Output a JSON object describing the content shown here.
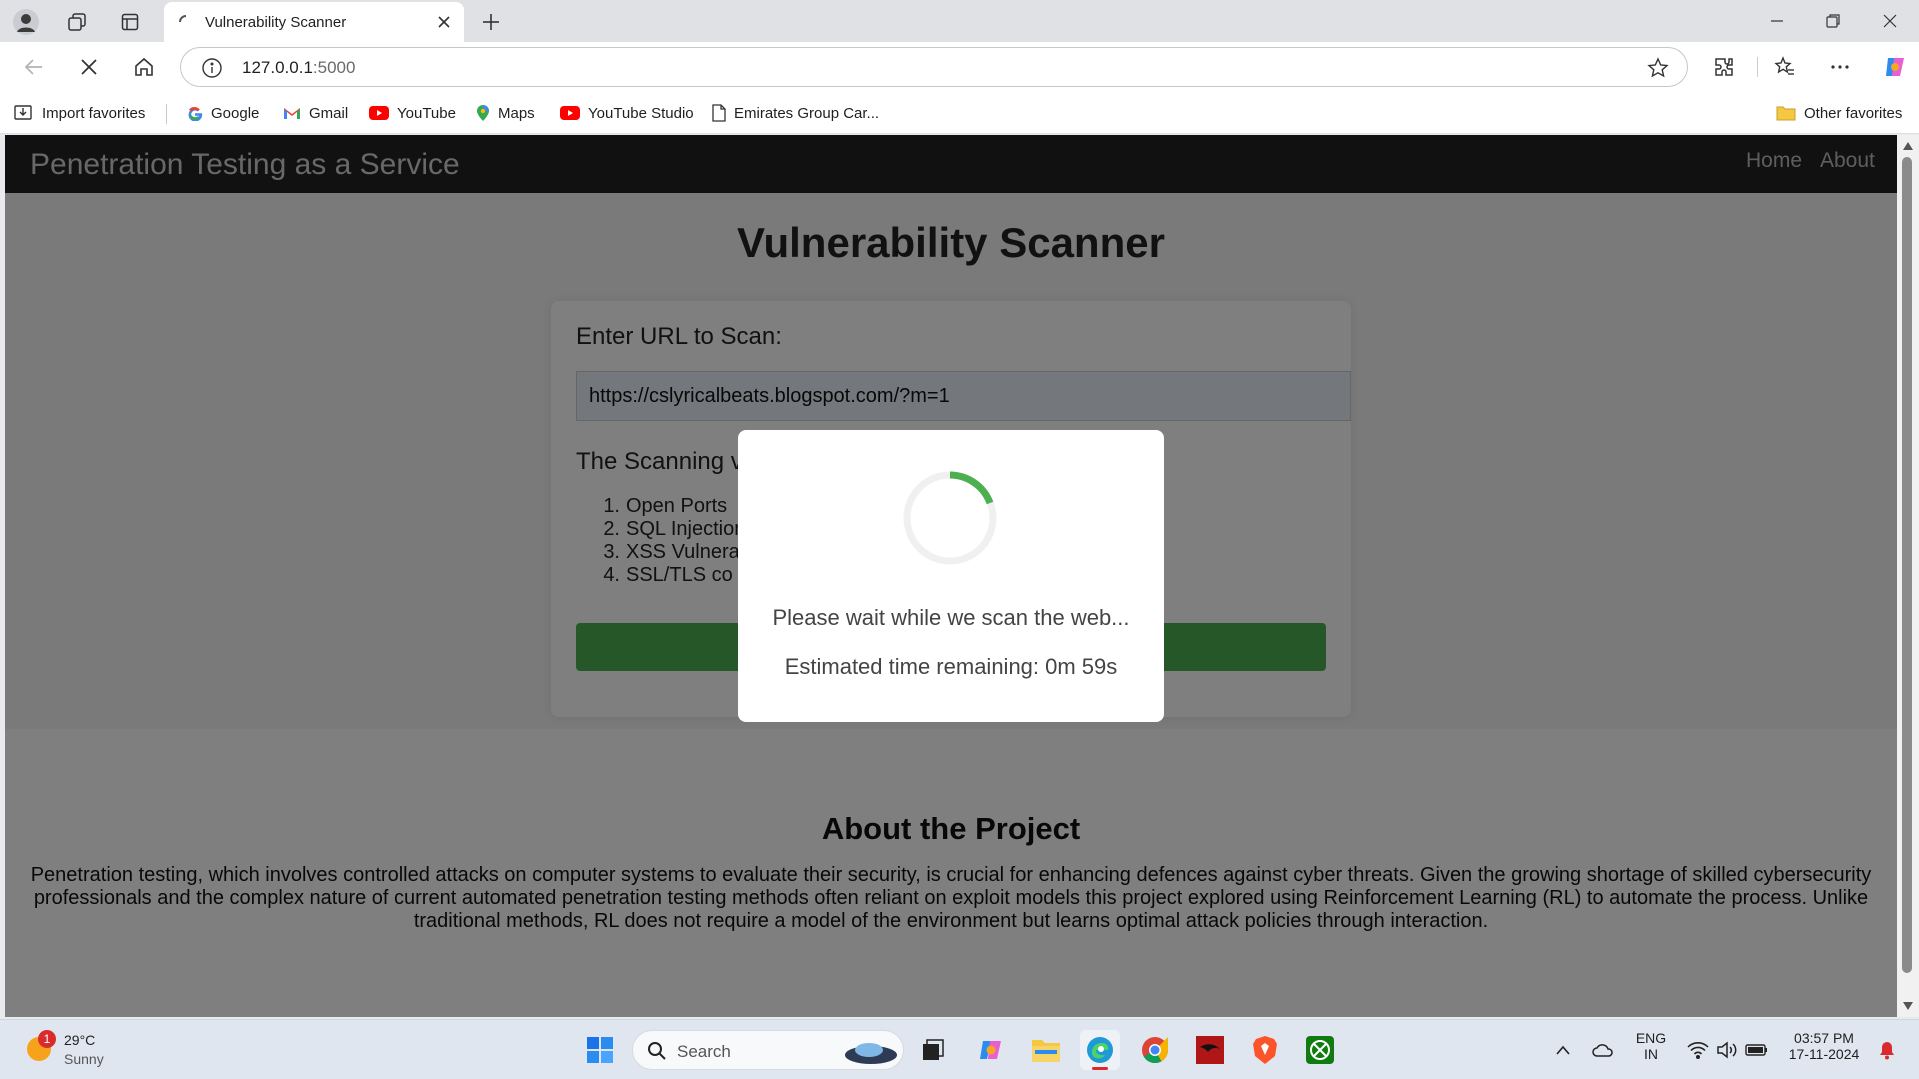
{
  "browser": {
    "tab_title": "Vulnerability Scanner",
    "url_host": "127.0.0.1",
    "url_port": ":5000",
    "bookmarks": [
      {
        "label": "Import favorites",
        "icon": "import-icon"
      },
      {
        "label": "Google",
        "icon": "google-icon"
      },
      {
        "label": "Gmail",
        "icon": "gmail-icon"
      },
      {
        "label": "YouTube",
        "icon": "youtube-icon"
      },
      {
        "label": "Maps",
        "icon": "maps-icon"
      },
      {
        "label": "YouTube Studio",
        "icon": "youtube-studio-icon"
      },
      {
        "label": "Emirates Group Car...",
        "icon": "document-icon"
      }
    ],
    "other_favorites": "Other favorites"
  },
  "site": {
    "brand": "Penetration Testing as a Service",
    "nav": {
      "home": "Home",
      "about": "About"
    },
    "title": "Vulnerability Scanner",
    "form": {
      "label": "Enter URL to Scan:",
      "url_value": "https://cslyricalbeats.blogspot.com/?m=1",
      "checks_heading": "The Scanning v",
      "checks": [
        "Open Ports",
        "SQL Injection",
        "XSS Vulnera",
        "SSL/TLS co"
      ]
    },
    "about": {
      "title": "About the Project",
      "text": "Penetration testing, which involves controlled attacks on computer systems to evaluate their security, is crucial for enhancing defences against cyber threats. Given the growing shortage of skilled cybersecurity professionals and the complex nature of current automated penetration testing methods often reliant on exploit models this project explored using Reinforcement Learning (RL) to automate the process. Unlike traditional methods, RL does not require a model of the environment but learns optimal attack policies through interaction."
    },
    "modal": {
      "message": "Please wait while we scan the web...",
      "eta": "Estimated time remaining: 0m 59s"
    },
    "colors": {
      "navbar": "#222222",
      "button": "#4caf50",
      "spinner": "#4caf50"
    }
  },
  "taskbar": {
    "weather": {
      "temp": "29°C",
      "condition": "Sunny",
      "badge": "1"
    },
    "search_label": "Search",
    "lang": "ENG",
    "region": "IN",
    "time": "03:57 PM",
    "date": "17-11-2024"
  }
}
